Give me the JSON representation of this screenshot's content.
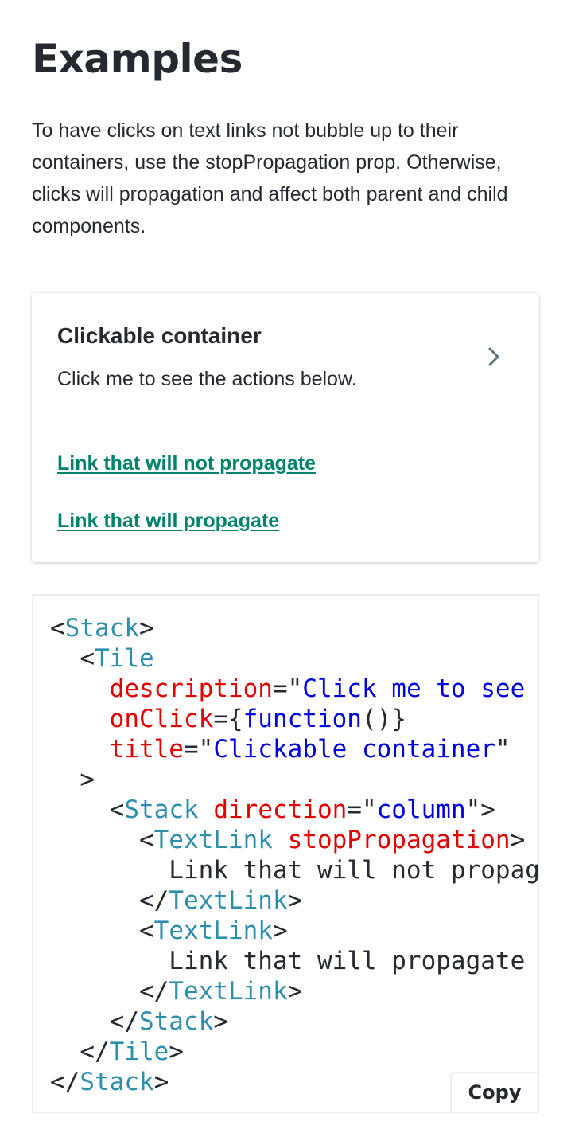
{
  "heading": "Examples",
  "description": "To have clicks on text links not bubble up to their containers, use the stopPropagation prop. Otherwise, clicks will propagation and affect both parent and child components.",
  "tile": {
    "title": "Clickable container",
    "description": "Click me to see the actions below.",
    "links": [
      "Link that will not propagate",
      "Link that will propagate"
    ]
  },
  "code": {
    "lines": [
      [
        [
          "p",
          "<"
        ],
        [
          "t",
          "Stack"
        ],
        [
          "p",
          ">"
        ]
      ],
      [
        [
          "p",
          "  <"
        ],
        [
          "t",
          "Tile"
        ]
      ],
      [
        [
          "a",
          "    description"
        ],
        [
          "p",
          "=\""
        ],
        [
          "s",
          "Click me to see the actions below."
        ],
        [
          "p",
          "\""
        ]
      ],
      [
        [
          "a",
          "    onClick"
        ],
        [
          "p",
          "={"
        ],
        [
          "f",
          "function"
        ],
        [
          "p",
          "()}"
        ]
      ],
      [
        [
          "a",
          "    title"
        ],
        [
          "p",
          "=\""
        ],
        [
          "s",
          "Clickable container"
        ],
        [
          "p",
          "\""
        ]
      ],
      [
        [
          "p",
          "  >"
        ]
      ],
      [
        [
          "p",
          "    <"
        ],
        [
          "t",
          "Stack"
        ],
        [
          "p",
          " "
        ],
        [
          "a",
          "direction"
        ],
        [
          "p",
          "=\""
        ],
        [
          "s",
          "column"
        ],
        [
          "p",
          "\">"
        ]
      ],
      [
        [
          "p",
          "      <"
        ],
        [
          "t",
          "TextLink"
        ],
        [
          "p",
          " "
        ],
        [
          "a",
          "stopPropagation"
        ],
        [
          "p",
          ">"
        ]
      ],
      [
        [
          "p",
          "        Link that will not propagate"
        ]
      ],
      [
        [
          "p",
          "      </"
        ],
        [
          "t",
          "TextLink"
        ],
        [
          "p",
          ">"
        ]
      ],
      [
        [
          "p",
          "      <"
        ],
        [
          "t",
          "TextLink"
        ],
        [
          "p",
          ">"
        ]
      ],
      [
        [
          "p",
          "        Link that will propagate"
        ]
      ],
      [
        [
          "p",
          "      </"
        ],
        [
          "t",
          "TextLink"
        ],
        [
          "p",
          ">"
        ]
      ],
      [
        [
          "p",
          "    </"
        ],
        [
          "t",
          "Stack"
        ],
        [
          "p",
          ">"
        ]
      ],
      [
        [
          "p",
          "  </"
        ],
        [
          "t",
          "Tile"
        ],
        [
          "p",
          ">"
        ]
      ],
      [
        [
          "p",
          "</"
        ],
        [
          "t",
          "Stack"
        ],
        [
          "p",
          ">"
        ]
      ]
    ],
    "copy_label": "Copy"
  },
  "icons": {
    "tile_chevron": "chevron-right-icon"
  },
  "colors": {
    "link": "#00826b",
    "code_tag": "#2e8eae",
    "code_attr": "#e30000",
    "code_string": "#0000e0",
    "text": "#252a31"
  }
}
